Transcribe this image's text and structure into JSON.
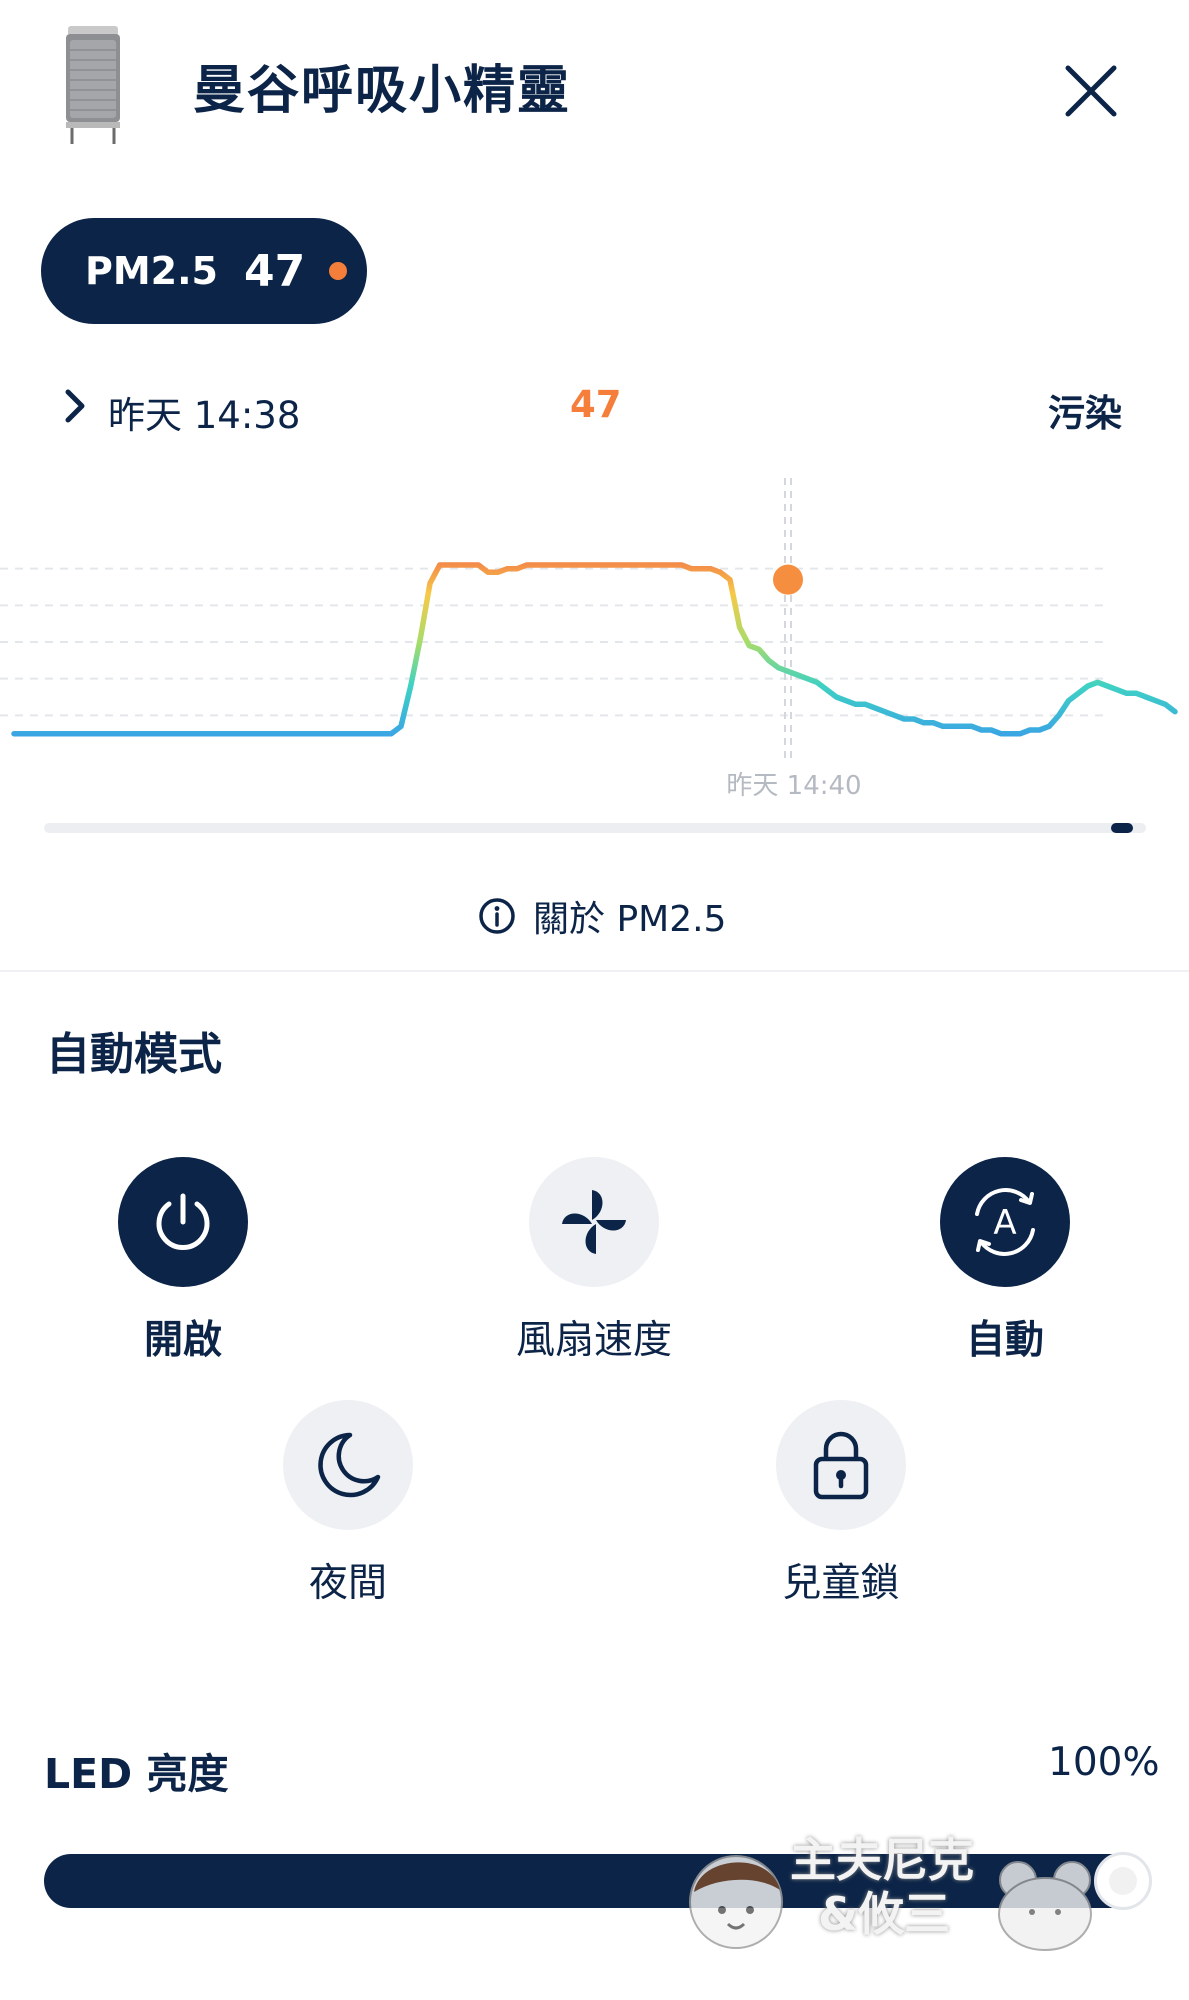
{
  "header": {
    "title": "曼谷呼吸小精靈",
    "device_image": "air-purifier-product-photo",
    "close_icon": "close-icon"
  },
  "pm_badge": {
    "label": "PM2.5",
    "value": "47",
    "status_color": "#f57e3b"
  },
  "chart_header": {
    "time": "昨天 14:38",
    "value": "47",
    "status": "污染"
  },
  "chart_data": {
    "type": "line",
    "series": [
      {
        "values": [
          5,
          5,
          5,
          5,
          5,
          5,
          5,
          5,
          5,
          5,
          5,
          5,
          5,
          5,
          5,
          5,
          5,
          5,
          5,
          5,
          5,
          5,
          5,
          5,
          5,
          5,
          5,
          5,
          5,
          5,
          5,
          5,
          5,
          5,
          5,
          5,
          5,
          5,
          5,
          5,
          7,
          18,
          31,
          46,
          51,
          51,
          51,
          51,
          51,
          49,
          49,
          50,
          50,
          51,
          51,
          51,
          51,
          51,
          51,
          51,
          51,
          51,
          51,
          51,
          51,
          51,
          51,
          51,
          51,
          51,
          50,
          50,
          50,
          49,
          47,
          34,
          29,
          28,
          25,
          23,
          22,
          21,
          20,
          19,
          17,
          15,
          14,
          13,
          13,
          12,
          11,
          10,
          9,
          9,
          8,
          8,
          7,
          7,
          7,
          7,
          6,
          6,
          5,
          5,
          5,
          6,
          6,
          7,
          10,
          14,
          16,
          18,
          19,
          18,
          17,
          16,
          16,
          15,
          14,
          13,
          11
        ]
      }
    ],
    "highlight_index": 80,
    "highlight_value": 47,
    "x_tick_label": "昨天 14:40",
    "ylim": [
      0,
      60
    ],
    "grid": true,
    "colors": {
      "low": "#3a97ee",
      "mid_low": "#3ed1c4",
      "mid": "#a8dc6a",
      "mid_high": "#f7c948",
      "high": "#ee4a4a",
      "marker": "#f58e3e"
    }
  },
  "about": {
    "label": "關於 PM2.5",
    "icon": "info-icon"
  },
  "mode": {
    "title": "自動模式"
  },
  "controls": [
    {
      "label": "開啟",
      "icon": "power-icon",
      "active": true
    },
    {
      "label": "風扇速度",
      "icon": "fan-icon",
      "active": false
    },
    {
      "label": "自動",
      "icon": "auto-mode-icon",
      "active": true
    },
    {
      "label": "夜間",
      "icon": "moon-icon",
      "active": false
    },
    {
      "label": "兒童鎖",
      "icon": "lock-icon",
      "active": false
    }
  ],
  "led": {
    "label": "LED 亮度",
    "value_text": "100%",
    "level": 1.0
  },
  "watermark": {
    "line1": "主夫尼克",
    "line2": "&攸三"
  }
}
